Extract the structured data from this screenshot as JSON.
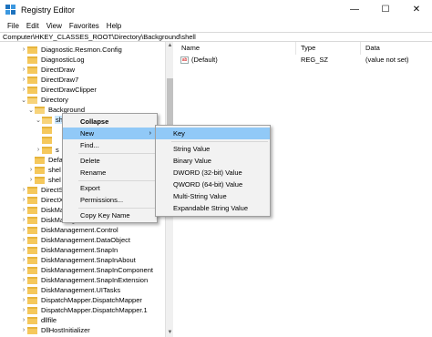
{
  "window": {
    "title": "Registry Editor",
    "controls": [
      "—",
      "☐",
      "✕"
    ]
  },
  "menu": [
    "File",
    "Edit",
    "View",
    "Favorites",
    "Help"
  ],
  "address": "Computer\\HKEY_CLASSES_ROOT\\Directory\\Background\\shell",
  "tree": {
    "items": [
      {
        "label": "Diagnostic.Resmon.Config",
        "chev": "›"
      },
      {
        "label": "DiagnosticLog",
        "chev": ""
      },
      {
        "label": "DirectDraw",
        "chev": "›"
      },
      {
        "label": "DirectDraw7",
        "chev": "›"
      },
      {
        "label": "DirectDrawClipper",
        "chev": "›"
      },
      {
        "label": "Directory",
        "chev": "⌄"
      },
      {
        "label": "Background",
        "chev": "⌄"
      },
      {
        "label": "sh",
        "chev": "⌄"
      },
      {
        "label": "",
        "chev": ""
      },
      {
        "label": "",
        "chev": ""
      },
      {
        "label": "s",
        "chev": "›"
      },
      {
        "label": "Defa",
        "chev": ""
      },
      {
        "label": "shel",
        "chev": "›"
      },
      {
        "label": "shel",
        "chev": "›"
      },
      {
        "label": "DirectS",
        "chev": "›"
      },
      {
        "label": "DirectX",
        "chev": "›"
      },
      {
        "label": "DiskMa",
        "chev": "›"
      },
      {
        "label": "DiskManagement.Connection",
        "chev": "›"
      },
      {
        "label": "DiskManagement.Control",
        "chev": "›"
      },
      {
        "label": "DiskManagement.DataObject",
        "chev": "›"
      },
      {
        "label": "DiskManagement.SnapIn",
        "chev": "›"
      },
      {
        "label": "DiskManagement.SnapInAbout",
        "chev": "›"
      },
      {
        "label": "DiskManagement.SnapInComponent",
        "chev": "›"
      },
      {
        "label": "DiskManagement.SnapInExtension",
        "chev": "›"
      },
      {
        "label": "DiskManagement.UITasks",
        "chev": "›"
      },
      {
        "label": "DispatchMapper.DispatchMapper",
        "chev": "›"
      },
      {
        "label": "DispatchMapper.DispatchMapper.1",
        "chev": "›"
      },
      {
        "label": "dllfile",
        "chev": "›"
      },
      {
        "label": "DllHostInitializer",
        "chev": "›"
      }
    ]
  },
  "values": {
    "headers": {
      "name": "Name",
      "type": "Type",
      "data": "Data"
    },
    "rows": [
      {
        "name": "(Default)",
        "type": "REG_SZ",
        "data": "(value not set)"
      }
    ]
  },
  "context_menu": {
    "items": [
      {
        "label": "Collapse",
        "bold": true
      },
      {
        "label": "New",
        "submenu": "›"
      },
      {
        "label": "Find..."
      },
      {
        "label": "Delete"
      },
      {
        "label": "Rename"
      },
      {
        "label": "Export"
      },
      {
        "label": "Permissions..."
      },
      {
        "label": "Copy Key Name"
      }
    ]
  },
  "new_submenu": {
    "items": [
      {
        "label": "Key"
      },
      {
        "label": "String Value"
      },
      {
        "label": "Binary Value"
      },
      {
        "label": "DWORD (32-bit) Value"
      },
      {
        "label": "QWORD (64-bit) Value"
      },
      {
        "label": "Multi-String Value"
      },
      {
        "label": "Expandable String Value"
      }
    ]
  },
  "colors": {
    "highlight": "#91c9f7",
    "folder": "#f5c85c",
    "selection": "#cce8ff"
  }
}
